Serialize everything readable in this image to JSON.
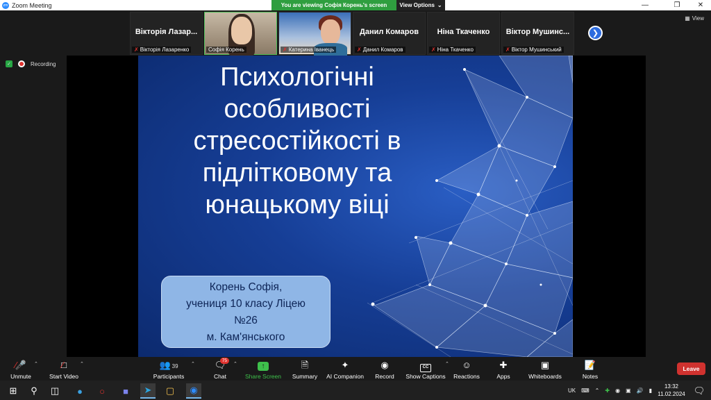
{
  "window": {
    "title": "Zoom Meeting",
    "banner_viewing": "You are viewing Софія Корень's screen",
    "banner_options": "View Options",
    "view_label": "View"
  },
  "participants_strip": [
    {
      "big": "Вікторія  Лазар...",
      "small": "Вікторія Лазаренко",
      "video": false
    },
    {
      "big": "",
      "small": "Софія Корень",
      "video": true
    },
    {
      "big": "",
      "small": "Катерина Іванець",
      "video": true
    },
    {
      "big": "Данил Комаров",
      "small": "Данил Комаров",
      "video": false
    },
    {
      "big": "Ніна Ткаченко",
      "small": "Ніна Ткаченко",
      "video": false
    },
    {
      "big": "Віктор  Мушинс...",
      "small": "Віктор Мушинський",
      "video": false
    }
  ],
  "status": {
    "recording": "Recording"
  },
  "slide": {
    "title_lines": [
      "Психологічні",
      "особливості",
      "стресостійкості в",
      "підлітковому та",
      "юнацькому віці"
    ],
    "caption_lines": [
      "Корень Софія,",
      "учениця 10 класу Ліцею",
      "№26",
      "м. Кам'янського"
    ]
  },
  "toolbar": {
    "unmute": "Unmute",
    "start_video": "Start Video",
    "participants": "Participants",
    "participants_count": "39",
    "chat": "Chat",
    "chat_badge": "75",
    "share_screen": "Share Screen",
    "summary": "Summary",
    "ai_companion": "AI Companion",
    "record": "Record",
    "show_captions": "Show Captions",
    "reactions": "Reactions",
    "apps": "Apps",
    "whiteboards": "Whiteboards",
    "notes": "Notes",
    "leave": "Leave",
    "cc_text": "CC"
  },
  "taskbar": {
    "lang": "UK",
    "time": "13:32",
    "date": "11.02.2024"
  }
}
